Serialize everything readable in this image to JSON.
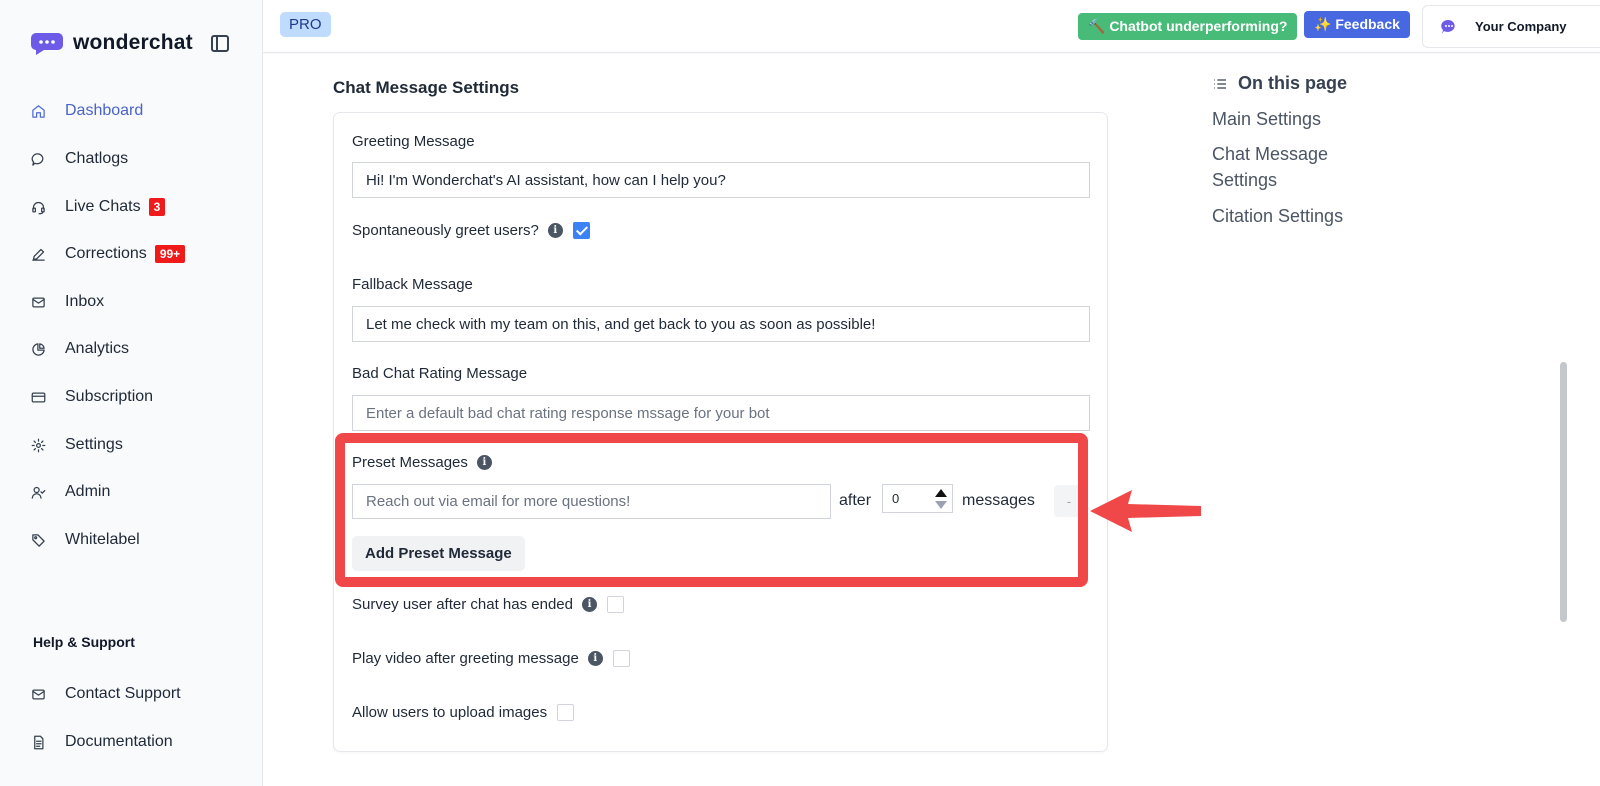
{
  "brand": {
    "name": "wonderchat"
  },
  "sidebar": {
    "items": [
      {
        "label": "Dashboard",
        "icon": "home-icon",
        "active": true
      },
      {
        "label": "Chatlogs",
        "icon": "chat-bubble-icon"
      },
      {
        "label": "Live Chats",
        "icon": "headset-icon",
        "badge": "3"
      },
      {
        "label": "Corrections",
        "icon": "pen-icon",
        "badge": "99+"
      },
      {
        "label": "Inbox",
        "icon": "mail-icon"
      },
      {
        "label": "Analytics",
        "icon": "pie-chart-icon"
      },
      {
        "label": "Subscription",
        "icon": "credit-card-icon"
      },
      {
        "label": "Settings",
        "icon": "gear-icon"
      },
      {
        "label": "Admin",
        "icon": "user-check-icon"
      },
      {
        "label": "Whitelabel",
        "icon": "tag-icon"
      }
    ],
    "help_title": "Help & Support",
    "help_items": [
      {
        "label": "Contact Support",
        "icon": "mail-icon"
      },
      {
        "label": "Documentation",
        "icon": "document-icon"
      }
    ]
  },
  "topbar": {
    "plan_badge": "PRO",
    "underperforming_label": "🔨 Chatbot underperforming?",
    "feedback_label": "✨ Feedback",
    "company_name": "Your Company"
  },
  "main": {
    "section_title": "Chat Message Settings",
    "greeting": {
      "label": "Greeting Message",
      "value": "Hi! I'm Wonderchat's AI assistant, how can I help you?"
    },
    "spontaneous_greet": {
      "label": "Spontaneously greet users?",
      "checked": true
    },
    "fallback": {
      "label": "Fallback Message",
      "value": "Let me check with my team on this, and get back to you as soon as possible!"
    },
    "bad_rating": {
      "label": "Bad Chat Rating Message",
      "placeholder": "Enter a default bad chat rating response mssage for your bot"
    },
    "preset": {
      "label": "Preset Messages",
      "placeholder": "Reach out via email for more questions!",
      "after_label": "after",
      "count_value": "0",
      "messages_label": "messages",
      "remove_label": "-",
      "add_button": "Add Preset Message"
    },
    "survey": {
      "label": "Survey user after chat has ended",
      "checked": false
    },
    "play_video": {
      "label": "Play video after greeting message",
      "checked": false
    },
    "upload_images": {
      "label": "Allow users to upload images",
      "checked": false
    }
  },
  "toc": {
    "title": "On this page",
    "items": [
      "Main Settings",
      "Chat Message Settings",
      "Citation Settings"
    ]
  },
  "colors": {
    "accent": "#4a63c9",
    "badge_red": "#ef1b1b",
    "highlight_red": "#f04848",
    "green_button": "#48bb78",
    "blue_button": "#4768e0"
  }
}
